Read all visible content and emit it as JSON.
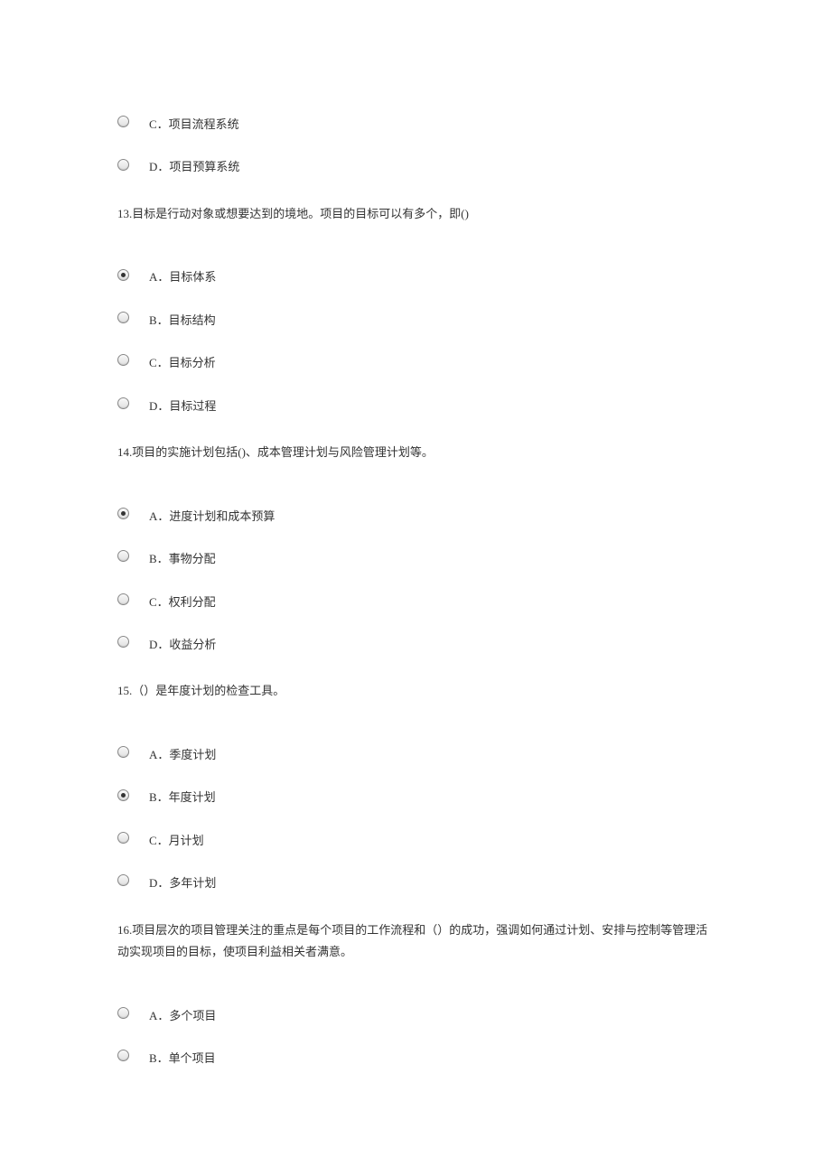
{
  "orphan_options": [
    {
      "label": "C．项目流程系统",
      "selected": false
    },
    {
      "label": "D．项目预算系统",
      "selected": false
    }
  ],
  "questions": [
    {
      "number": "13",
      "text": "13.目标是行动对象或想要达到的境地。项目的目标可以有多个，即()",
      "options": [
        {
          "label": "A．目标体系",
          "selected": true
        },
        {
          "label": "B．目标结构",
          "selected": false
        },
        {
          "label": "C．目标分析",
          "selected": false
        },
        {
          "label": "D．目标过程",
          "selected": false
        }
      ]
    },
    {
      "number": "14",
      "text": "14.项目的实施计划包括()、成本管理计划与风险管理计划等。",
      "options": [
        {
          "label": "A．进度计划和成本预算",
          "selected": true
        },
        {
          "label": "B．事物分配",
          "selected": false
        },
        {
          "label": "C．权利分配",
          "selected": false
        },
        {
          "label": "D．收益分析",
          "selected": false
        }
      ]
    },
    {
      "number": "15",
      "text": "15.（）是年度计划的检查工具。",
      "options": [
        {
          "label": "A．季度计划",
          "selected": false
        },
        {
          "label": "B．年度计划",
          "selected": true
        },
        {
          "label": "C．月计划",
          "selected": false
        },
        {
          "label": "D．多年计划",
          "selected": false
        }
      ]
    },
    {
      "number": "16",
      "text": "16.项目层次的项目管理关注的重点是每个项目的工作流程和（）的成功，强调如何通过计划、安排与控制等管理活动实现项目的目标，使项目利益相关者满意。",
      "options": [
        {
          "label": "A．多个项目",
          "selected": false
        },
        {
          "label": "B．单个项目",
          "selected": false
        }
      ]
    }
  ]
}
